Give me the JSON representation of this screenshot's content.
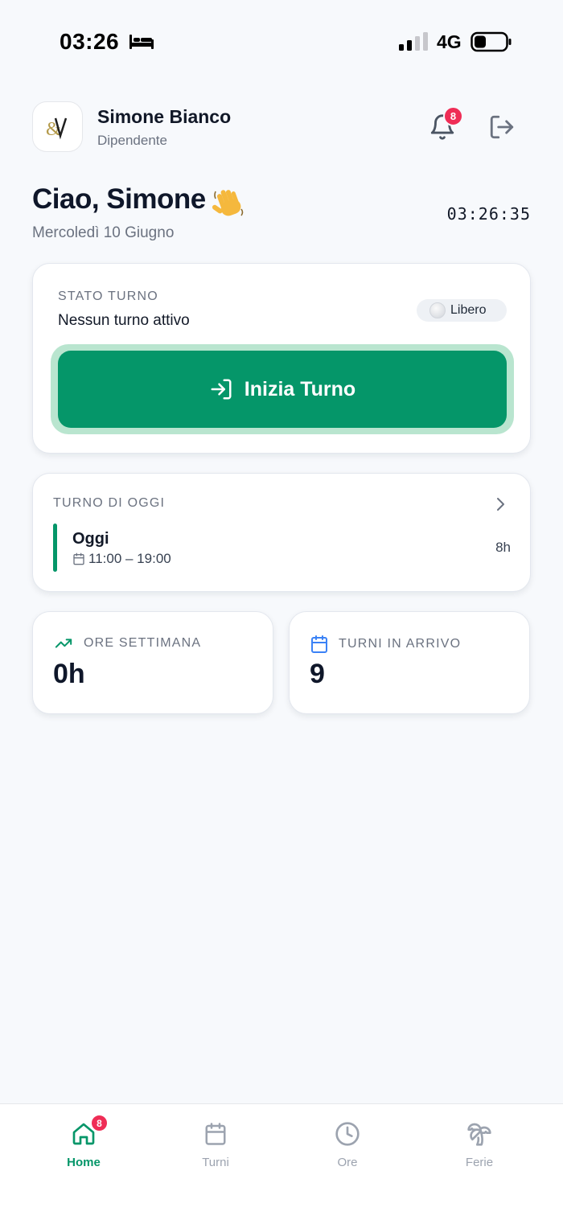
{
  "status_bar": {
    "time": "03:26",
    "network": "4G"
  },
  "header": {
    "name": "Simone Bianco",
    "role": "Dipendente",
    "notification_count": "8"
  },
  "greeting": {
    "title": "Ciao, Simone",
    "date": "Mercoledì 10 Giugno",
    "clock": "03:26:35"
  },
  "shift_status": {
    "label": "STATO TURNO",
    "text": "Nessun turno attivo",
    "badge": "Libero",
    "button_label": "Inizia Turno"
  },
  "today_shift": {
    "label": "TURNO DI OGGI",
    "title": "Oggi",
    "time": "11:00 – 19:00",
    "hours": "8h"
  },
  "stats": {
    "week": {
      "label": "ORE SETTIMANA",
      "value": "0h"
    },
    "upcoming": {
      "label": "TURNI IN ARRIVO",
      "value": "9"
    }
  },
  "nav": {
    "items": [
      {
        "label": "Home",
        "icon": "home-icon",
        "active": true,
        "badge": "8"
      },
      {
        "label": "Turni",
        "icon": "calendar-icon"
      },
      {
        "label": "Ore",
        "icon": "clock-icon"
      },
      {
        "label": "Ferie",
        "icon": "palm-tree-icon"
      }
    ]
  },
  "colors": {
    "accent": "#059669",
    "badge": "#ef2d56",
    "text_primary": "#0f172a",
    "text_muted": "#6b7280"
  }
}
